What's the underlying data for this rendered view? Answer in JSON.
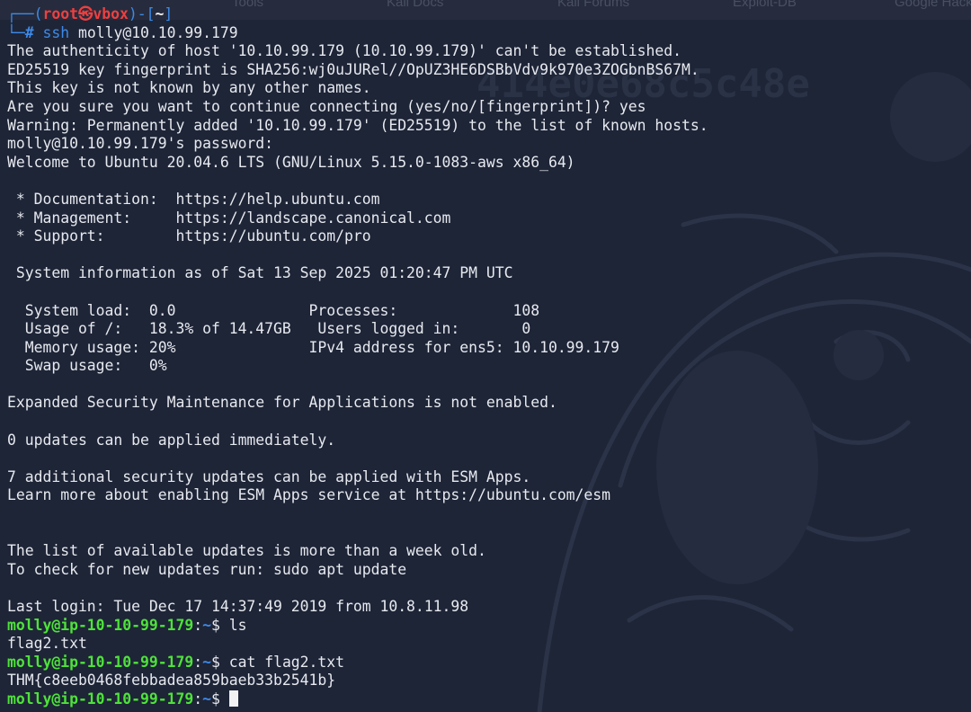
{
  "bookmarks": [
    "Tools",
    "Kali Docs",
    "Kali Forums",
    "Kali NetHunter",
    "Exploit-DB",
    "Google Hacking DB"
  ],
  "root_prompt": {
    "user": "root",
    "skull": "㉿",
    "host": "vbox",
    "cwd": "~",
    "symbol": "#"
  },
  "ssh_command": {
    "program": "ssh",
    "args": "molly@10.10.99.179"
  },
  "ssh_output": [
    "The authenticity of host '10.10.99.179 (10.10.99.179)' can't be established.",
    "ED25519 key fingerprint is SHA256:wj0uJURel//OpUZ3HE6DSBbVdv9k970e3ZOGbnBS67M.",
    "This key is not known by any other names.",
    "Are you sure you want to continue connecting (yes/no/[fingerprint])? yes",
    "Warning: Permanently added '10.10.99.179' (ED25519) to the list of known hosts.",
    "molly@10.10.99.179's password:",
    "Welcome to Ubuntu 20.04.6 LTS (GNU/Linux 5.15.0-1083-aws x86_64)"
  ],
  "motd_links": [
    " * Documentation:  https://help.ubuntu.com",
    " * Management:     https://landscape.canonical.com",
    " * Support:        https://ubuntu.com/pro"
  ],
  "sysinfo_header": " System information as of Sat 13 Sep 2025 01:20:47 PM UTC",
  "sysinfo_rows": [
    "  System load:  0.0               Processes:             108",
    "  Usage of /:   18.3% of 14.47GB   Users logged in:       0",
    "  Memory usage: 20%               IPv4 address for ens5: 10.10.99.179",
    "  Swap usage:   0%"
  ],
  "esm_notice": "Expanded Security Maintenance for Applications is not enabled.",
  "updates_now": "0 updates can be applied immediately.",
  "esm_updates": [
    "7 additional security updates can be applied with ESM Apps.",
    "Learn more about enabling ESM Apps service at https://ubuntu.com/esm"
  ],
  "stale_updates": [
    "The list of available updates is more than a week old.",
    "To check for new updates run: sudo apt update"
  ],
  "last_login": "Last login: Tue Dec 17 14:37:49 2019 from 10.8.11.98",
  "remote_prompt": {
    "userhost": "molly@ip-10-10-99-179",
    "cwd": "~",
    "symbol": "$"
  },
  "session": [
    {
      "command": "ls",
      "output": "flag2.txt"
    },
    {
      "command": "cat flag2.txt",
      "output": "THM{c8eeb0468febbadea859baeb33b2541b}"
    }
  ],
  "colors": {
    "background": "#1e2537",
    "prompt_bracket": "#3d8ae8",
    "prompt_root_user": "#ef3f3f",
    "prompt_remote_user": "#4ee23a",
    "text": "#e7e9ef"
  }
}
